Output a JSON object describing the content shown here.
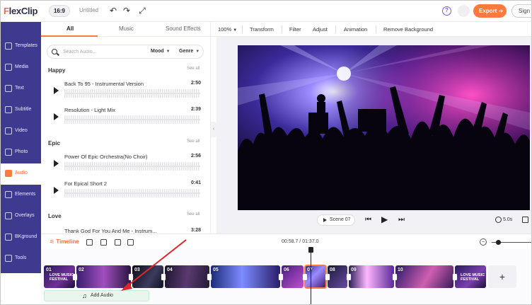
{
  "header": {
    "logo_text": "lexClip",
    "logo_letter": "F",
    "ratio": "16:9",
    "project_title": "Untitled",
    "export_label": "Export",
    "signin_label": "Sign"
  },
  "sidebar": {
    "items": [
      {
        "label": "Templates"
      },
      {
        "label": "Media"
      },
      {
        "label": "Text"
      },
      {
        "label": "Subtitle"
      },
      {
        "label": "Video"
      },
      {
        "label": "Photo"
      },
      {
        "label": "Audio"
      },
      {
        "label": "Elements"
      },
      {
        "label": "Overlays"
      },
      {
        "label": "BKground"
      },
      {
        "label": "Tools"
      }
    ],
    "active": "Audio"
  },
  "panel": {
    "tabs": [
      {
        "label": "All"
      },
      {
        "label": "Music"
      },
      {
        "label": "Sound Effects"
      }
    ],
    "search": {
      "placeholder": "Search Audio...",
      "mood_label": "Mood",
      "genre_label": "Genre"
    },
    "see_all": "See all",
    "categories": [
      {
        "name": "Happy",
        "tracks": [
          {
            "title": "Back To 95 - Instrumental Version",
            "duration": "2:50"
          },
          {
            "title": "Resolution - Light Mix",
            "duration": "2:39"
          }
        ]
      },
      {
        "name": "Epic",
        "tracks": [
          {
            "title": "Power Of Epic Orchestra(No Choir)",
            "duration": "2:56"
          },
          {
            "title": "For Epical Short 2",
            "duration": "0:41"
          }
        ]
      },
      {
        "name": "Love",
        "tracks": [
          {
            "title": "Thank God For You And Me - Instrum...",
            "duration": "3:28"
          }
        ]
      }
    ]
  },
  "toolbar": {
    "zoom": "100%",
    "items": [
      {
        "label": "Transform"
      },
      {
        "label": "Filter"
      },
      {
        "label": "Adjust"
      },
      {
        "label": "Animation"
      },
      {
        "label": "Remove Background"
      }
    ]
  },
  "preview": {
    "scene_label": "Scene  07",
    "duration": "5.0s"
  },
  "timeline": {
    "label": "Timeline",
    "time_readout": "00:58.7 / 01:37.0",
    "add_audio_label": "Add Audio",
    "clips": [
      {
        "num": "01",
        "caption": "LOVE MUSIC\nFESTIVAL"
      },
      {
        "num": "02",
        "caption": ""
      },
      {
        "num": "03",
        "caption": ""
      },
      {
        "num": "04",
        "caption": ""
      },
      {
        "num": "05",
        "caption": ""
      },
      {
        "num": "06",
        "caption": ""
      },
      {
        "num": "07",
        "caption": ""
      },
      {
        "num": "08",
        "caption": ""
      },
      {
        "num": "09",
        "caption": ""
      },
      {
        "num": "10",
        "caption": ""
      },
      {
        "num": "",
        "caption": "LOVE MUSIC\nFESTIVAL"
      }
    ]
  },
  "colors": {
    "accent": "#ff7a3d",
    "sidebar": "#3e3a8f",
    "annotation_arrow": "#e0262b"
  }
}
